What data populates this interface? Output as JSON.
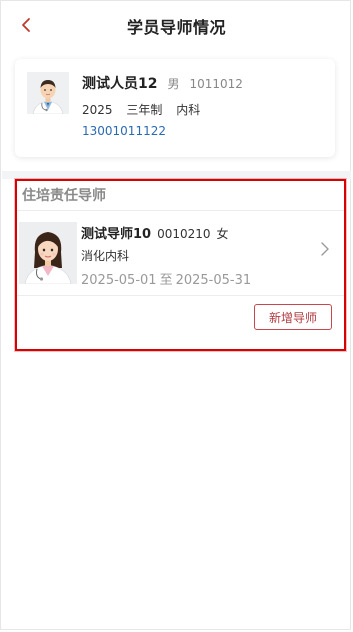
{
  "header": {
    "title": "学员导师情况"
  },
  "student": {
    "name": "测试人员12",
    "gender": "男",
    "id": "1011012",
    "year": "2025",
    "program": "三年制",
    "department": "内科",
    "phone": "13001011122"
  },
  "mentor_section": {
    "title": "住培责任导师",
    "mentors": [
      {
        "name": "测试导师10",
        "id": "0010210",
        "gender": "女",
        "department": "消化内科",
        "start_date": "2025-05-01",
        "to_label": "至",
        "end_date": "2025-05-31"
      }
    ],
    "add_button_label": "新增导师"
  },
  "colors": {
    "accent": "#b03a40",
    "link": "#2a6ab3",
    "highlight_border": "#d80000"
  }
}
